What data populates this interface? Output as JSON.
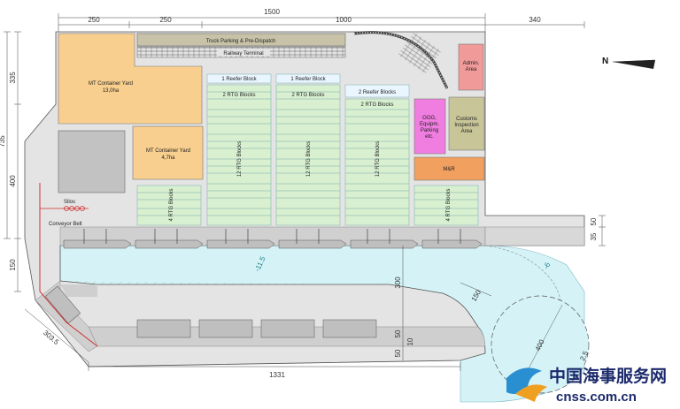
{
  "dimensions": {
    "top_total": "1500",
    "top_seg1": "250",
    "top_seg2": "250",
    "top_seg3": "1000",
    "top_right": "340",
    "left_335": "335",
    "left_735": "735",
    "left_400": "400",
    "left_150": "150",
    "diag_303_5": "303.5",
    "bottom_1331": "1331",
    "right_50": "50",
    "right_35": "35",
    "basin_300": "300",
    "basin_150": "150",
    "basin_400": "400",
    "basin_2_5": "2.5",
    "center_50a": "50",
    "center_10": "10",
    "center_50b": "50"
  },
  "depths": {
    "depth_11_5": "-11.5",
    "depth_6": "-6"
  },
  "areas": {
    "truck_parking": "Truck Parking & Pre-Dispatch",
    "railway_terminal": "Railway Terminal",
    "mt_yard_large_name": "MT Container Yard",
    "mt_yard_large_size": "13,0ha",
    "mt_yard_small_name": "MT Container Yard",
    "mt_yard_small_size": "4,7ha",
    "admin_line1": "Admin.",
    "admin_line2": "Area",
    "oog_lines": [
      "OOG,",
      "Equipm.",
      "Parking",
      "etc."
    ],
    "customs_lines": [
      "Customs",
      "Inspection",
      "Area"
    ],
    "mr": "M&R",
    "silos": "Silos",
    "conveyor": "Conveyor Belt",
    "reefer_1": "1 Reefer Block",
    "reefer_2": "1 Reefer Block",
    "reefer_3": "2 Reefer Blocks",
    "rtg2_1": "2 RTG Blocks",
    "rtg2_2": "2 RTG Blocks",
    "rtg2_3": "2 RTG Blocks",
    "rtg12_1": "12 RTG Blocks",
    "rtg12_2": "12 RTG Blocks",
    "rtg12_3": "12 RTG Blocks",
    "rtg4_left": "4 RTG Blocks",
    "rtg4_right": "4 RTG Blocks"
  },
  "compass": {
    "label": "N"
  },
  "watermark": {
    "chinese": "中国海事服务网",
    "url": "cnss.com.cn"
  },
  "colors": {
    "yard": "#f8cf8e",
    "rtg": "#d8f0d0",
    "water": "#d5f3f7",
    "pink": "#f07de0",
    "orange": "#f2a060",
    "customs": "#c8c698",
    "admin": "#f09a9a",
    "pavement": "#d6d6d6",
    "darkgray": "#c2c2c2"
  }
}
